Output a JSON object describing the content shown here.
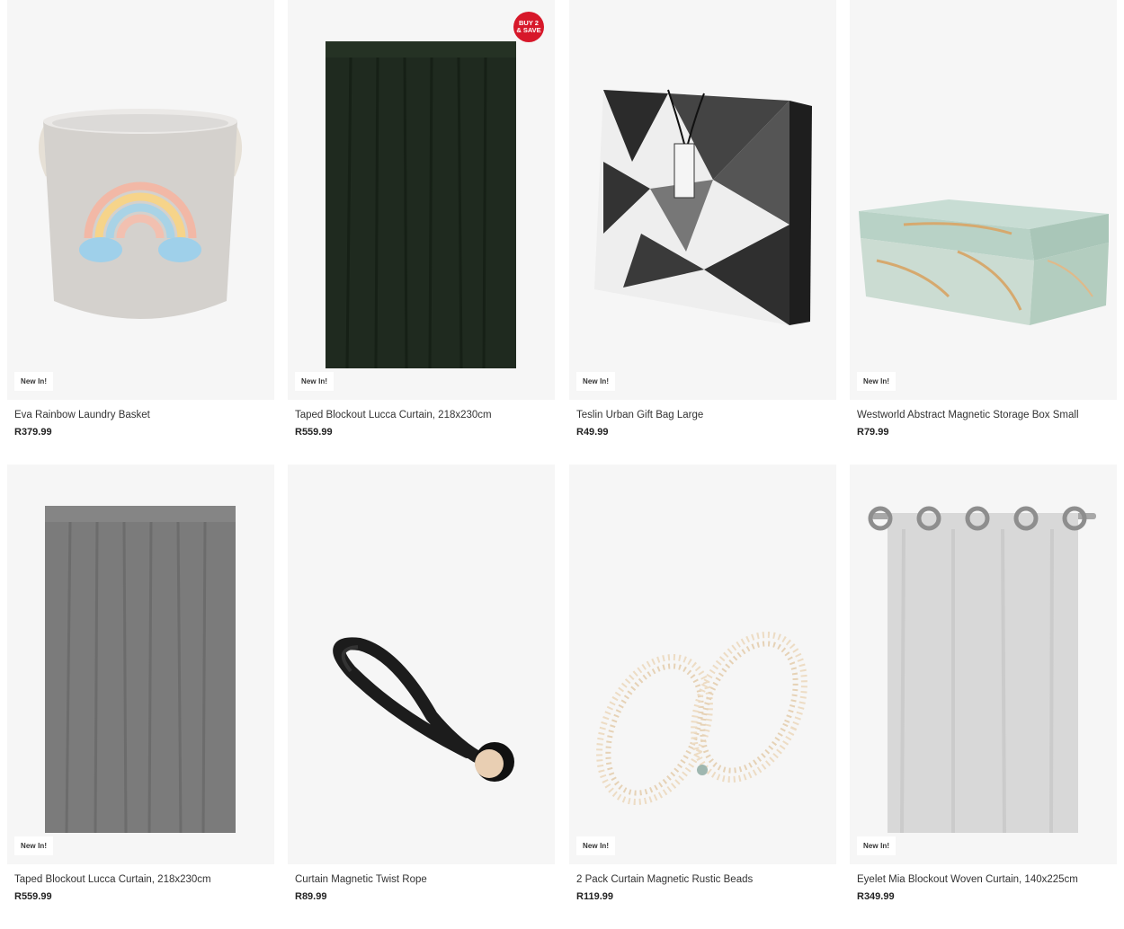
{
  "products": [
    {
      "name": "Eva Rainbow Laundry Basket",
      "price": "R379.99",
      "badge": "New In!",
      "icon": "laundry-basket-image"
    },
    {
      "name": "Taped Blockout Lucca Curtain, 218x230cm",
      "price": "R559.99",
      "badge": "New In!",
      "promo_line1": "BUY 2",
      "promo_line2": "& SAVE",
      "icon": "green-curtain-image"
    },
    {
      "name": "Teslin Urban Gift Bag Large",
      "price": "R49.99",
      "badge": "New In!",
      "icon": "gift-bag-image"
    },
    {
      "name": "Westworld Abstract Magnetic Storage Box Small",
      "price": "R79.99",
      "badge": "New In!",
      "icon": "storage-box-image"
    },
    {
      "name": "Taped Blockout Lucca Curtain, 218x230cm",
      "price": "R559.99",
      "badge": "New In!",
      "icon": "grey-curtain-image"
    },
    {
      "name": "Curtain Magnetic Twist Rope",
      "price": "R89.99",
      "icon": "twist-rope-image"
    },
    {
      "name": "2 Pack Curtain Magnetic Rustic Beads",
      "price": "R119.99",
      "badge": "New In!",
      "icon": "rustic-beads-image"
    },
    {
      "name": "Eyelet Mia Blockout Woven Curtain, 140x225cm",
      "price": "R349.99",
      "badge": "New In!",
      "icon": "eyelet-curtain-image"
    }
  ],
  "colors": {
    "promo": "#d7182a",
    "tile_bg": "#f6f6f6"
  }
}
